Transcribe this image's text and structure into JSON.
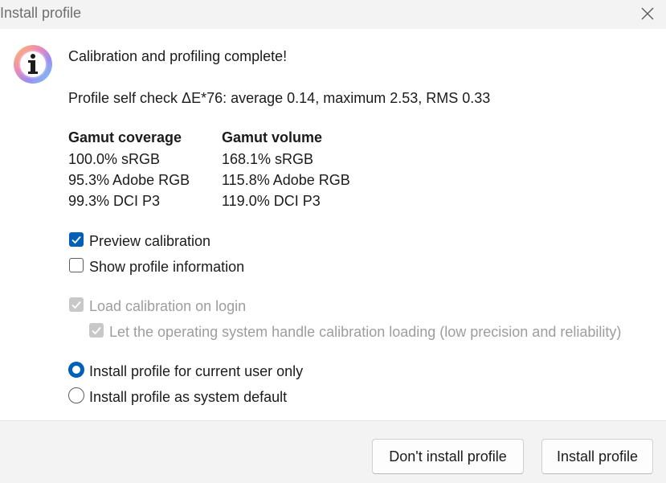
{
  "window": {
    "title": "Install profile",
    "close_icon": "close-icon"
  },
  "message": {
    "icon": "info-icon",
    "heading": "Calibration and profiling complete!",
    "self_check": "Profile self check ΔE*76: average 0.14, maximum 2.53, RMS 0.33"
  },
  "gamut": {
    "coverage": {
      "header": "Gamut coverage",
      "rows": [
        "100.0% sRGB",
        "95.3% Adobe RGB",
        "99.3% DCI P3"
      ]
    },
    "volume": {
      "header": "Gamut volume",
      "rows": [
        "168.1% sRGB",
        "115.8% Adobe RGB",
        "119.0% DCI P3"
      ]
    }
  },
  "options": {
    "preview_calibration": {
      "label": "Preview calibration",
      "checked": true
    },
    "show_profile_info": {
      "label": "Show profile information",
      "checked": false
    },
    "load_on_login": {
      "label": "Load calibration on login",
      "checked": true,
      "disabled": true
    },
    "os_handle_loading": {
      "label": "Let the operating system handle calibration loading (low precision and reliability)",
      "checked": true,
      "disabled": true
    }
  },
  "install_scope": {
    "current_user": {
      "label": "Install profile for current user only",
      "selected": true
    },
    "system_default": {
      "label": "Install profile as system default",
      "selected": false
    }
  },
  "buttons": {
    "dont_install": "Don't install profile",
    "install": "Install profile"
  },
  "colors": {
    "accent": "#005fb8",
    "disabled": "#c8c8c8",
    "disabled_text": "#9d9d9d"
  }
}
